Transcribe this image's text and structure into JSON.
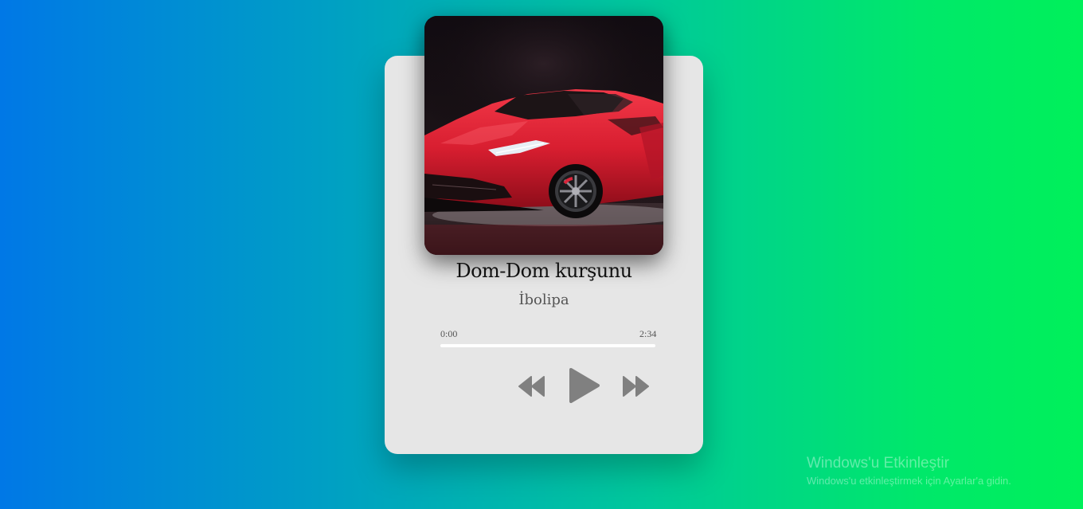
{
  "player": {
    "cover_icon": "sports-car-artwork",
    "title": "Dom-Dom kurşunu",
    "artist": "İbolipa",
    "current_time": "0:00",
    "total_time": "2:34",
    "progress_fraction": 0,
    "controls": {
      "prev_icon": "rewind-icon",
      "play_icon": "play-icon",
      "next_icon": "fast-forward-icon"
    }
  },
  "watermark": {
    "title": "Windows'u Etkinleştir",
    "subtitle": "Windows'u etkinleştirmek için Ayarlar'a gidin."
  },
  "colors": {
    "background_start": "#0078e6",
    "background_end": "#00f05a",
    "card": "#e6e6e6",
    "control": "#808080",
    "car_red": "#e0283a"
  }
}
